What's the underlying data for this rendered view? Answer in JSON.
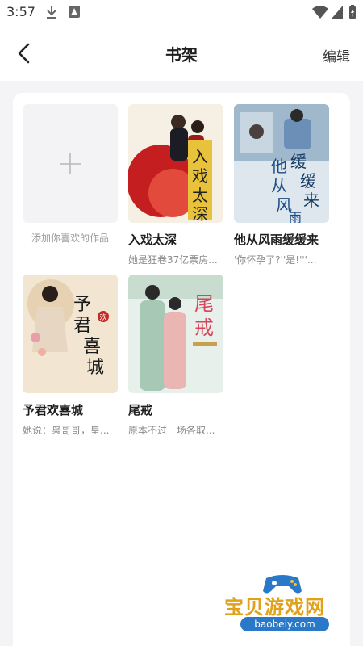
{
  "status_bar": {
    "time": "3:57"
  },
  "header": {
    "title": "书架",
    "edit_label": "编辑"
  },
  "add_card": {
    "label": "添加你喜欢的作品"
  },
  "books": [
    {
      "title": "入戏太深",
      "desc": "她是狂卷37亿票房...",
      "cover_title": "入戏太深"
    },
    {
      "title": "他从风雨缓缓来",
      "desc": "'你怀孕了?''是!'''...",
      "cover_title": "他从风雨缓缓来"
    },
    {
      "title": "予君欢喜城",
      "desc": "她说：枭哥哥，皇...",
      "cover_title": "予君欢喜城"
    },
    {
      "title": "尾戒",
      "desc": "原本不过一场各取...",
      "cover_title": "尾戒"
    }
  ],
  "watermark": {
    "name": "宝贝游戏网",
    "url": "baobeiy.com"
  },
  "colors": {
    "accent": "#e0a21c",
    "watermark_blue": "#2a78c8"
  }
}
